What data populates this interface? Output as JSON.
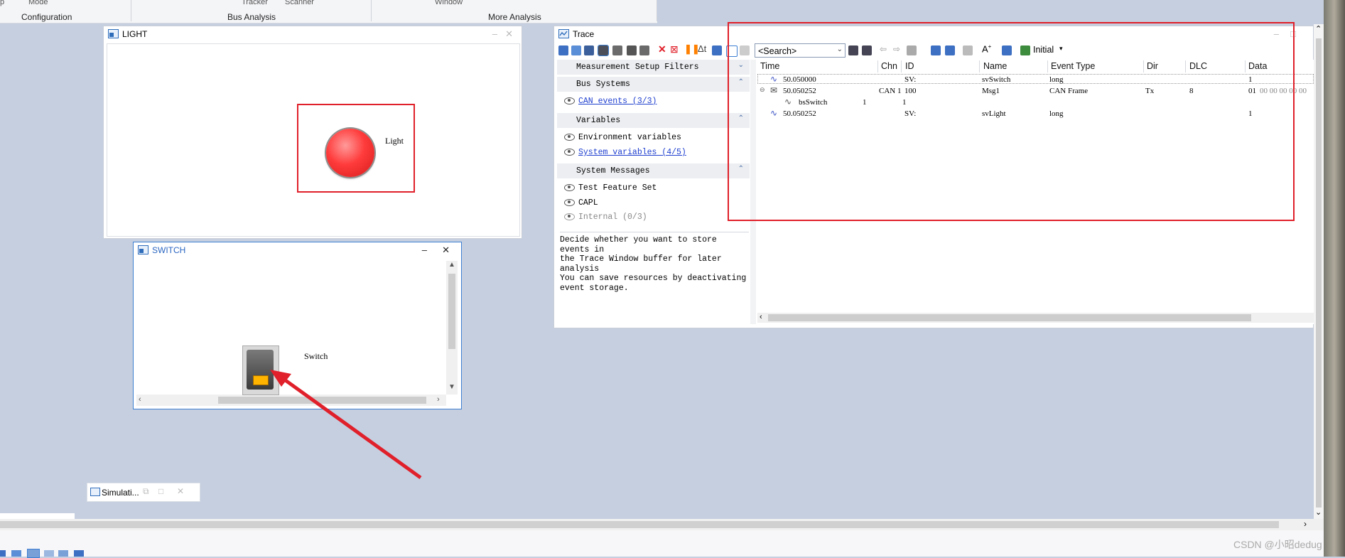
{
  "ribbon": {
    "top_labels": [
      "p",
      "Mode",
      "Tracker",
      "Scanner",
      "Window"
    ],
    "groups": [
      "Configuration",
      "Bus Analysis",
      "More Analysis"
    ]
  },
  "light_window": {
    "title": "LIGHT",
    "label": "Light",
    "lamp_color": "#ff3b3b"
  },
  "switch_window": {
    "title": "SWITCH",
    "label": "Switch"
  },
  "trace": {
    "title": "Trace",
    "search_placeholder": "<Search>",
    "initial_label": "Initial",
    "filters": {
      "measurement_setup": "Measurement Setup Filters",
      "bus_systems": "Bus Systems",
      "can_events": "CAN events (3/3)",
      "variables": "Variables",
      "environment_variables": "Environment variables",
      "system_variables": "System variables (4/5)",
      "system_messages": "System Messages",
      "test_feature_set": "Test Feature Set",
      "capl": "CAPL",
      "internal": "Internal (0/3)"
    },
    "description": [
      "Decide whether you want to store events in",
      "the Trace Window buffer for later analysis",
      "You can save resources by deactivating",
      "event storage."
    ],
    "columns": [
      "Time",
      "Chn",
      "ID",
      "Name",
      "Event Type",
      "Dir",
      "DLC",
      "Data"
    ],
    "rows": [
      {
        "time": "50.050000",
        "chn": "",
        "id": "SV:",
        "name": "svSwitch",
        "type": "long",
        "dir": "",
        "dlc": "",
        "data": "1"
      },
      {
        "time": "50.050252",
        "chn": "CAN 1",
        "id": "100",
        "name": "Msg1",
        "type": "CAN Frame",
        "dir": "Tx",
        "dlc": "8",
        "data": "01",
        "data_rest": "00 00 00 00 00"
      },
      {
        "time": "bsSwitch",
        "chn": "1",
        "id": "1",
        "name": "",
        "type": "",
        "dir": "",
        "dlc": "",
        "data": ""
      },
      {
        "time": "50.050252",
        "chn": "",
        "id": "SV:",
        "name": "svLight",
        "type": "long",
        "dir": "",
        "dlc": "",
        "data": "1"
      }
    ]
  },
  "simulation_tab": {
    "label": "Simulati..."
  },
  "watermark": "CSDN @小昭dedug",
  "colors": {
    "annotation_red": "#e0202a",
    "desktop": "#c5cfe0",
    "link_blue": "#1f3fcf"
  }
}
